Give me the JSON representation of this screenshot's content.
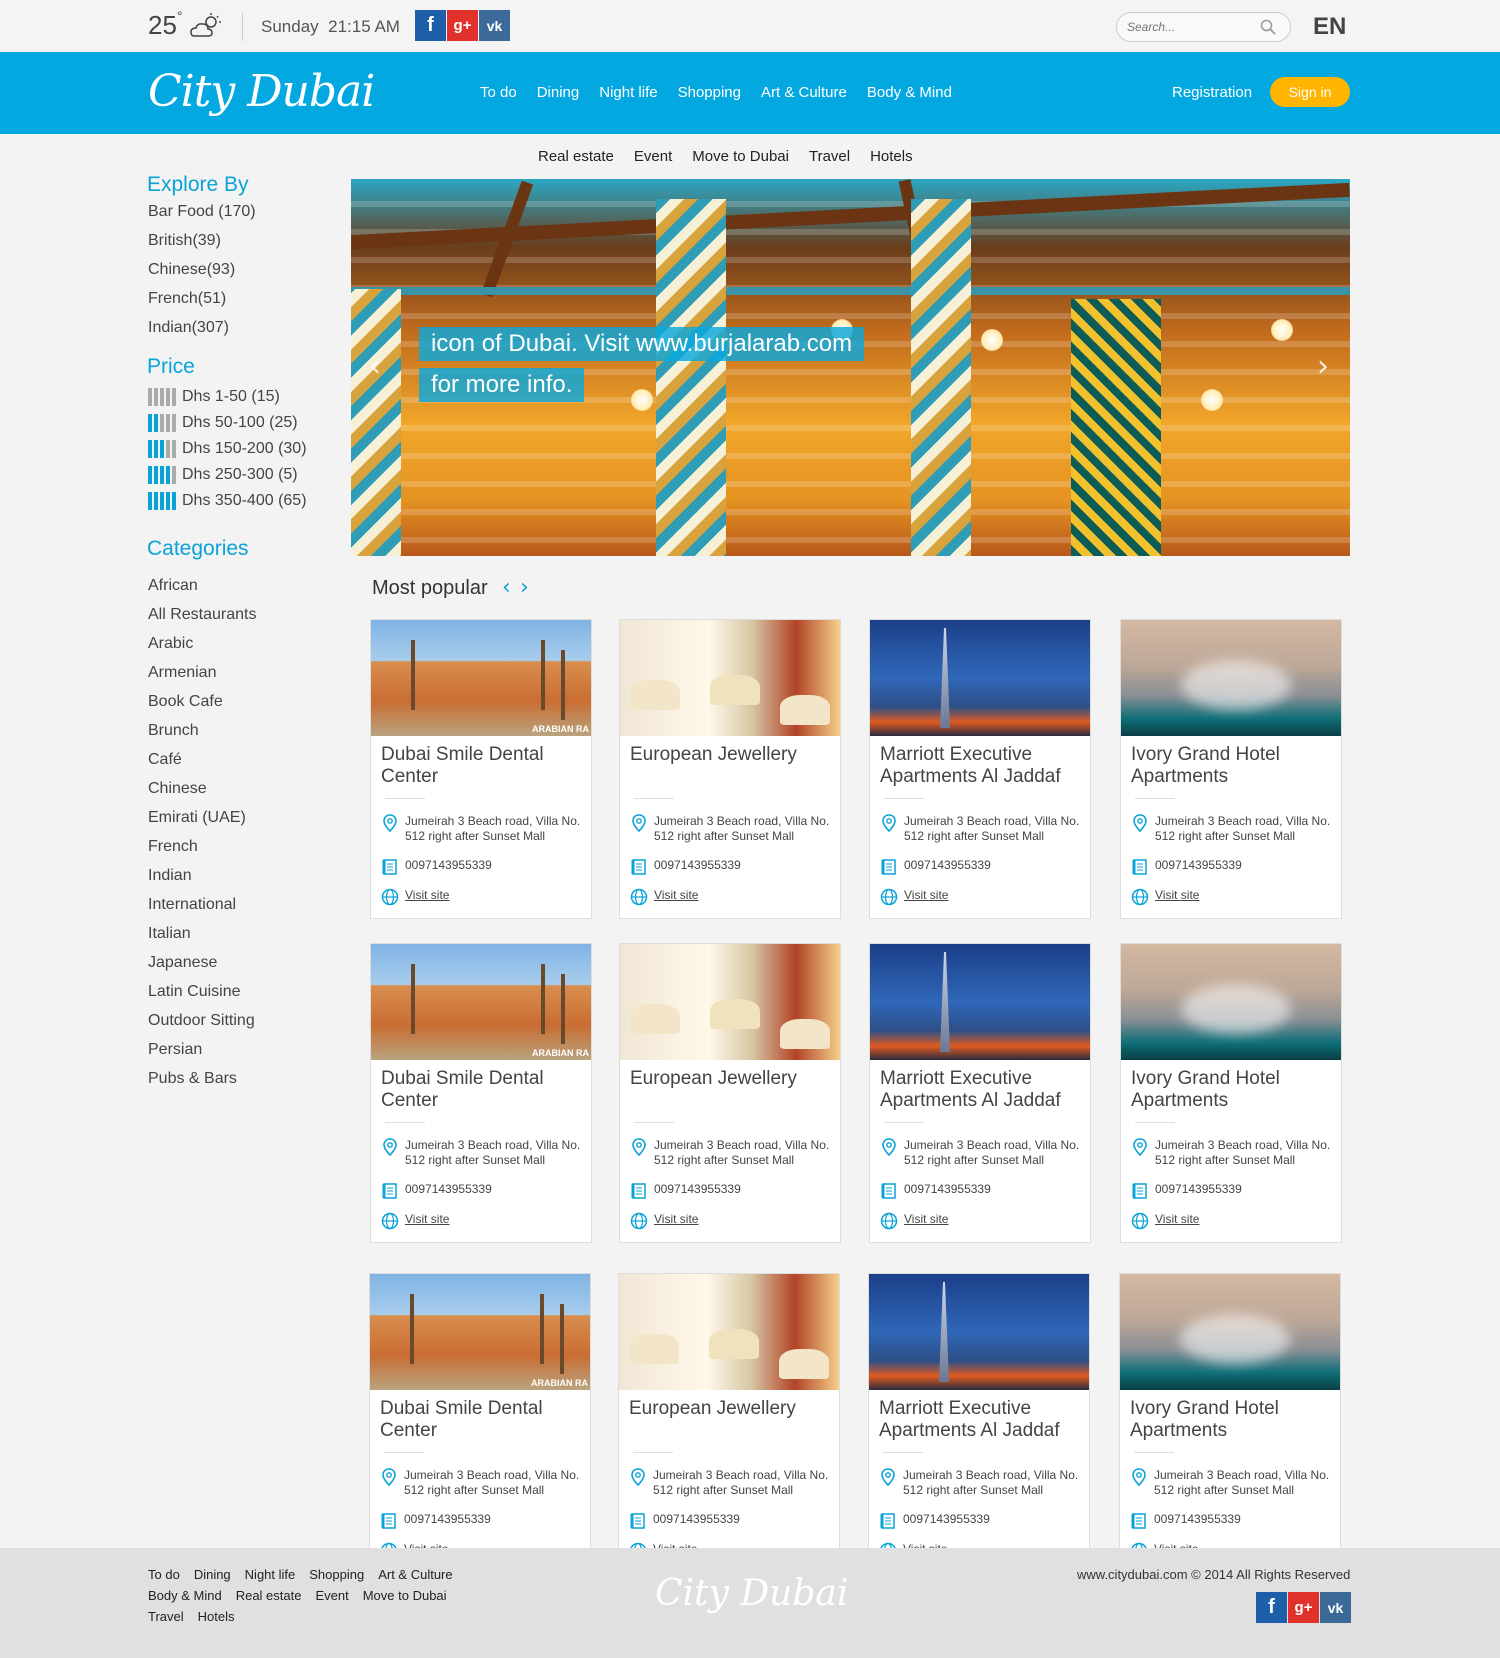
{
  "topbar": {
    "temperature": "25",
    "degree": "°",
    "day": "Sunday",
    "time": "21:15 AM",
    "search_placeholder": "Search...",
    "language": "EN",
    "icons": [
      "partly-cloudy-icon",
      "facebook-icon",
      "google-plus-icon",
      "vk-icon",
      "search-icon"
    ]
  },
  "header": {
    "logo": "City Dubai",
    "nav": [
      "To do",
      "Dining",
      "Night life",
      "Shopping",
      "Art & Culture",
      "Body & Mind"
    ],
    "registration": "Registration",
    "sign_in": "Sign in"
  },
  "subnav": [
    "Real estate",
    "Event",
    "Move to Dubai",
    "Travel",
    "Hotels"
  ],
  "sidebar": {
    "explore_title": "Explore By",
    "explore": [
      "Bar Food (170)",
      "British(39)",
      "Chinese(93)",
      "French(51)",
      "Indian(307)"
    ],
    "price_title": "Price",
    "price": [
      {
        "label": "Dhs 1-50 (15)",
        "level": 0
      },
      {
        "label": "Dhs 50-100 (25)",
        "level": 2
      },
      {
        "label": "Dhs 150-200 (30)",
        "level": 3
      },
      {
        "label": "Dhs 250-300 (5)",
        "level": 4
      },
      {
        "label": "Dhs 350-400 (65)",
        "level": 5
      }
    ],
    "categories_title": "Categories",
    "categories": [
      "African",
      "All Restaurants",
      "Arabic",
      "Armenian",
      "Book Cafe",
      "Brunch",
      "Café",
      "Chinese",
      "Emirati (UAE)",
      "French",
      "Indian",
      "International",
      "Italian",
      "Japanese",
      "Latin Cuisine",
      "Outdoor Sitting",
      "Persian",
      "Pubs & Bars"
    ]
  },
  "hero": {
    "caption_line1": "icon of Dubai. Visit www.burjalarab.com",
    "caption_line2": "for more info.",
    "prev": "‹",
    "next": "›"
  },
  "popular": {
    "title": "Most popular",
    "prev": "‹",
    "next": "›",
    "address": "Jumeirah 3 Beach road, Villa No. 512 right after Sunset Mall",
    "phone": "0097143955339",
    "visit": "Visit site",
    "cards": [
      {
        "title": "Dubai Smile Dental Center",
        "thumb": "t1",
        "tag": "ARABIAN RA"
      },
      {
        "title": "European Jewellery",
        "thumb": "t2",
        "tag": ""
      },
      {
        "title": "Marriott Executive Apartments Al Jaddaf",
        "thumb": "t3",
        "tag": ""
      },
      {
        "title": "Ivory Grand Hotel Apartments",
        "thumb": "t4",
        "tag": ""
      }
    ]
  },
  "footer": {
    "nav": [
      "To do",
      "Dining",
      "Night life",
      "Shopping",
      "Art & Culture",
      "Body & Mind",
      "Real estate",
      "Event",
      "Move to Dubai",
      "Travel",
      "Hotels"
    ],
    "logo": "City Dubai",
    "copyright": "www.citydubai.com © 2014  All Rights Reserved"
  },
  "colors": {
    "brand_blue": "#04a8e1",
    "accent_yellow": "#ffb400",
    "footer_bg": "#e0e0e0"
  }
}
